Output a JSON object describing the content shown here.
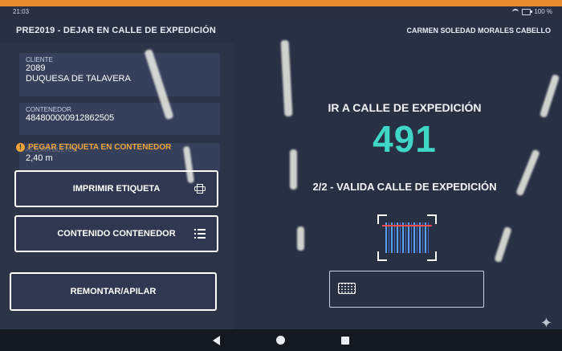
{
  "status_bar": {
    "time": "21:03",
    "battery": "100 %"
  },
  "header": {
    "title": "PRE2019 - DEJAR EN CALLE DE EXPEDICIÓN",
    "user": "CARMEN SOLEDAD MORALES CABELLO"
  },
  "info": {
    "client_label": "CLIENTE",
    "client_code": "2089",
    "client_name": "DUQUESA DE TALAVERA",
    "container_label": "CONTENEDOR",
    "container_value": "484800000912862505",
    "height_label": "ALTURA BULTOS",
    "height_value": "2,40 m"
  },
  "warning": {
    "text": "PEGAR ETIQUETA EN CONTENEDOR",
    "icon": "alert-icon"
  },
  "buttons": {
    "print_label": "IMPRIMIR ETIQUETA",
    "print_icon": "printer-icon",
    "content_label": "CONTENIDO CONTENEDOR",
    "content_icon": "list-icon",
    "stack_label": "REMONTAR/APILAR"
  },
  "main": {
    "instruction": "IR A CALLE DE EXPEDICIÓN",
    "street_number": "491",
    "step": "2/2 - VALIDA CALLE DE EXPEDICIÓN",
    "scan_icon": "barcode-scan-icon",
    "input_icon": "keyboard-icon"
  },
  "colors": {
    "accent_number": "#3fd6c6",
    "warning": "#f0a336",
    "top_strip": "#e88a2e"
  }
}
